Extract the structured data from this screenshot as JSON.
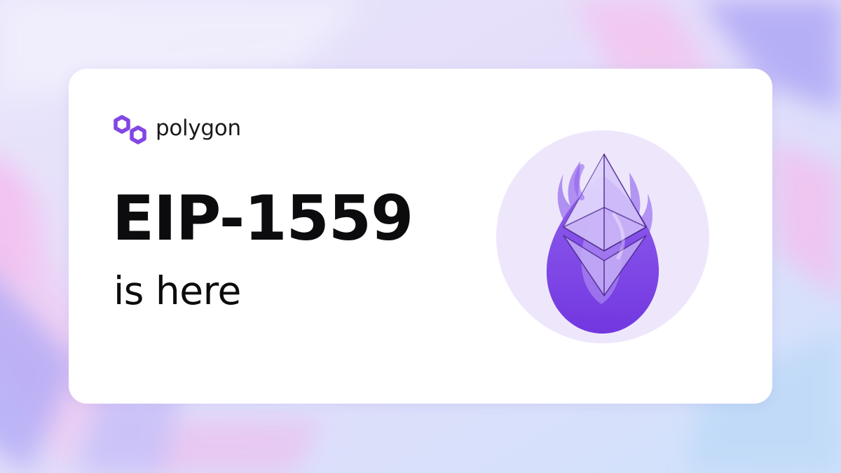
{
  "brand": {
    "name": "polygon",
    "color": "#8247e5"
  },
  "headline": "EIP-1559",
  "subline": "is here",
  "illustration": {
    "icon": "ethereum-flame-icon",
    "circle_color": "#eee7fc",
    "flame_color": "#7b3fe4"
  }
}
